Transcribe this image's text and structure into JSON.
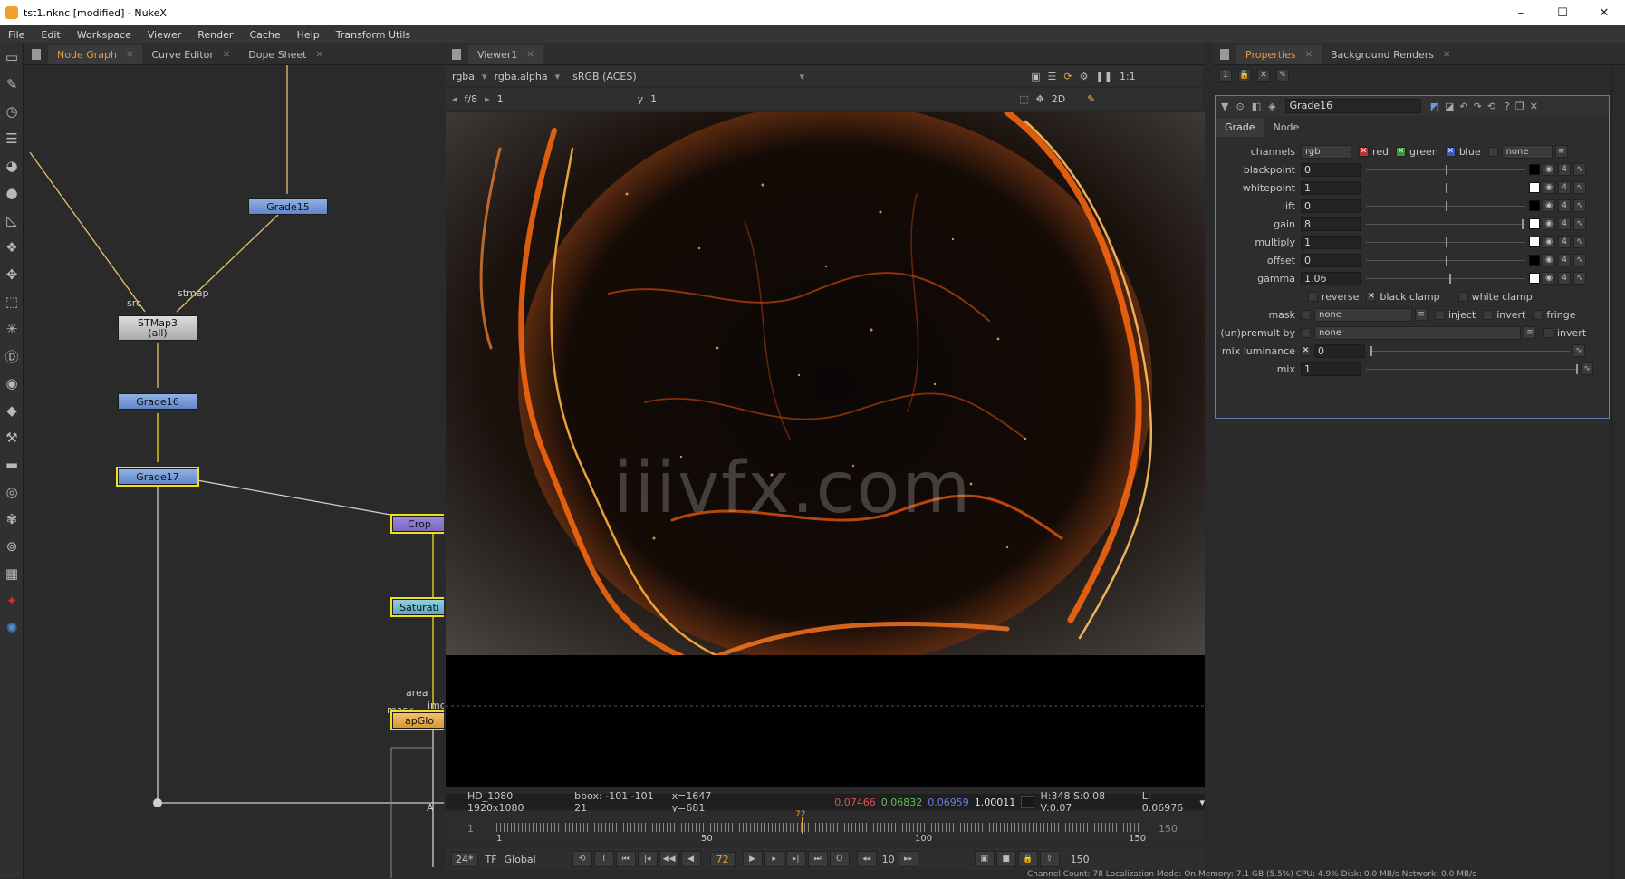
{
  "window": {
    "title": "tst1.nknc [modified] - NukeX",
    "min": "–",
    "max": "☐",
    "close": "✕"
  },
  "menu": [
    "File",
    "Edit",
    "Workspace",
    "Viewer",
    "Render",
    "Cache",
    "Help",
    "Transform Utils"
  ],
  "left_tabs": [
    {
      "label": "Node Graph",
      "active": true
    },
    {
      "label": "Curve Editor",
      "active": false
    },
    {
      "label": "Dope Sheet",
      "active": false
    }
  ],
  "viewer_tab": {
    "label": "Viewer1"
  },
  "right_tabs": [
    {
      "label": "Properties",
      "active": true
    },
    {
      "label": "Background Renders",
      "active": false
    }
  ],
  "nodes": {
    "grade15": "Grade15",
    "stmap3_line1": "STMap3",
    "stmap3_line2": "(all)",
    "grade16": "Grade16",
    "grade17": "Grade17",
    "crop": "Crop",
    "saturation": "Saturati",
    "apglow": "apGlo"
  },
  "node_labels": {
    "src": "src",
    "stmap": "stmap",
    "area": "area",
    "mask": "mask",
    "img": "img",
    "a": "A"
  },
  "viewer": {
    "channels": "rgba",
    "alpha": "rgba.alpha",
    "colorspace": "sRGB (ACES)",
    "zoom": "1:1",
    "fstop": "f/8",
    "gain_val": "1",
    "gamma_label": "y",
    "gamma_val": "1",
    "view_mode": "2D",
    "watermark": "iiivfx.com"
  },
  "info": {
    "format": "HD_1080 1920x1080",
    "bbox": "bbox: -101 -101 21",
    "coords": "x=1647 y=681",
    "r": "0.07466",
    "g": "0.06832",
    "b": "0.06959",
    "a": "1.00011",
    "hsv": "H:348 S:0.08 V:0.07",
    "lum": "L: 0.06976"
  },
  "timeline": {
    "start": "1",
    "end": "150",
    "current": "72",
    "ticks": [
      "1",
      "50",
      "100",
      "150"
    ],
    "left_num": "1",
    "right_num": "150"
  },
  "transport": {
    "fps": "24*",
    "tf": "TF",
    "global": "Global",
    "frame": "72",
    "step": "10",
    "end": "150"
  },
  "properties": {
    "node_name": "Grade16",
    "sub_tabs": [
      "Grade",
      "Node"
    ],
    "channels_label": "channels",
    "channels_value": "rgb",
    "red": "red",
    "green": "green",
    "blue": "blue",
    "none": "none",
    "params": [
      {
        "label": "blackpoint",
        "value": "0",
        "swatch": "#000000"
      },
      {
        "label": "whitepoint",
        "value": "1",
        "swatch": "#ffffff"
      },
      {
        "label": "lift",
        "value": "0",
        "swatch": "#000000"
      },
      {
        "label": "gain",
        "value": "8",
        "swatch": "#ffffff"
      },
      {
        "label": "multiply",
        "value": "1",
        "swatch": "#ffffff"
      },
      {
        "label": "offset",
        "value": "0",
        "swatch": "#000000"
      },
      {
        "label": "gamma",
        "value": "1.06",
        "swatch": "#ffffff"
      }
    ],
    "reverse": "reverse",
    "black_clamp": "black clamp",
    "white_clamp": "white clamp",
    "mask_label": "mask",
    "mask_value": "none",
    "inject": "inject",
    "invert": "invert",
    "fringe": "fringe",
    "unpremult_label": "(un)premult by",
    "unpremult_value": "none",
    "unpremult_invert": "invert",
    "mix_luminance_label": "mix luminance",
    "mix_luminance_value": "0",
    "mix_label": "mix",
    "mix_value": "1",
    "count": "4"
  },
  "status": "Channel Count: 78  Localization Mode: On  Memory: 7.1 GB (5.5%)  CPU: 4.9%  Disk: 0.0 MB/s  Network: 0.0 MB/s"
}
